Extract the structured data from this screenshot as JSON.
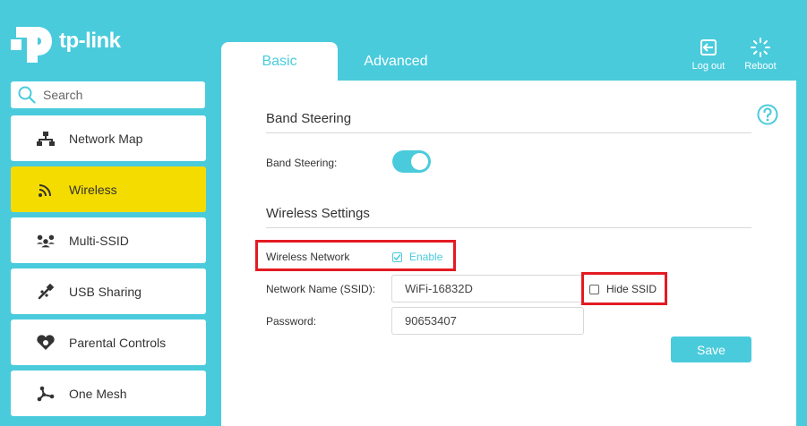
{
  "brand": {
    "name": "tp-link"
  },
  "search": {
    "placeholder": "Search"
  },
  "sidebar": {
    "items": [
      {
        "label": "Network Map",
        "icon": "network-map-icon",
        "active": false
      },
      {
        "label": "Wireless",
        "icon": "wifi-icon",
        "active": true
      },
      {
        "label": "Multi-SSID",
        "icon": "multi-ssid-icon",
        "active": false
      },
      {
        "label": "USB Sharing",
        "icon": "usb-icon",
        "active": false
      },
      {
        "label": "Parental Controls",
        "icon": "heart-icon",
        "active": false
      },
      {
        "label": "One Mesh",
        "icon": "mesh-icon",
        "active": false
      }
    ]
  },
  "tabs": [
    {
      "label": "Basic",
      "active": true
    },
    {
      "label": "Advanced",
      "active": false
    }
  ],
  "top_actions": {
    "logout_label": "Log out",
    "reboot_label": "Reboot"
  },
  "band_steering": {
    "section_title": "Band Steering",
    "label": "Band Steering:",
    "enabled": true
  },
  "wireless_settings": {
    "section_title": "Wireless Settings",
    "network_label": "Wireless Network",
    "enable_label": "Enable",
    "enable_checked": true,
    "ssid_label": "Network Name (SSID):",
    "ssid_value": "WiFi-16832D",
    "hide_ssid_label": "Hide SSID",
    "hide_ssid_checked": false,
    "password_label": "Password:",
    "password_value": "90653407",
    "save_label": "Save"
  },
  "colors": {
    "accent": "#4acbdc",
    "active_nav": "#f5dc00",
    "highlight": "#e31b23"
  }
}
